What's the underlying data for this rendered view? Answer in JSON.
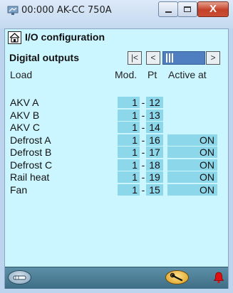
{
  "window": {
    "title": "00:000 AK-CC 750A",
    "close_glyph": "X"
  },
  "page": {
    "title": "I/O configuration",
    "section": "Digital outputs"
  },
  "nav": {
    "first_glyph": "|<",
    "prev_glyph": "<",
    "next_glyph": ">"
  },
  "columns": {
    "load": "Load",
    "mod": "Mod.",
    "pt": "Pt",
    "active": "Active at"
  },
  "rows": [
    {
      "load": "AKV A",
      "mod": "1",
      "pt": "12",
      "active": ""
    },
    {
      "load": "AKV B",
      "mod": "1",
      "pt": "13",
      "active": ""
    },
    {
      "load": "AKV C",
      "mod": "1",
      "pt": "14",
      "active": ""
    },
    {
      "load": "Defrost A",
      "mod": "1",
      "pt": "16",
      "active": "ON"
    },
    {
      "load": "Defrost B",
      "mod": "1",
      "pt": "17",
      "active": "ON"
    },
    {
      "load": "Defrost C",
      "mod": "1",
      "pt": "18",
      "active": "ON"
    },
    {
      "load": "Rail heat",
      "mod": "1",
      "pt": "19",
      "active": "ON"
    },
    {
      "load": "Fan",
      "mod": "1",
      "pt": "15",
      "active": "ON"
    }
  ],
  "icons": {
    "app": "network-icon",
    "home": "home-icon",
    "footer_left": "hand-tool-icon",
    "footer_mid": "wrench-icon",
    "alarm": "alarm-bell-icon"
  },
  "colors": {
    "client_bg": "#ccf6ff",
    "cell_bg": "#8dd7eb",
    "scrollbar": "#4f7fc1",
    "footer": "#4f7f97",
    "alarm": "#e01010"
  }
}
